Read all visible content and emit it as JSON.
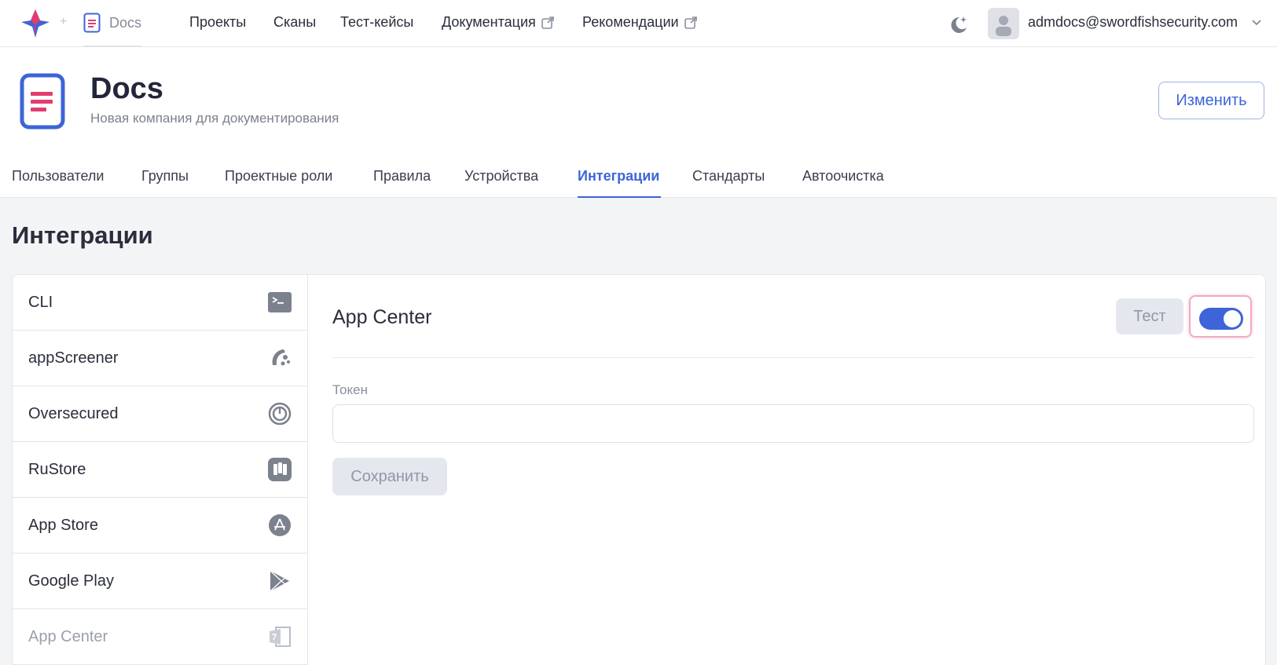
{
  "topbar": {
    "breadcrumb_label": "Docs",
    "breadcrumb_separator": "+",
    "nav": [
      {
        "label": "Проекты",
        "external": false
      },
      {
        "label": "Сканы",
        "external": false
      },
      {
        "label": "Тест-кейсы",
        "external": false
      },
      {
        "label": "Документация",
        "external": true
      },
      {
        "label": "Рекомендации",
        "external": true
      }
    ],
    "theme_icon": "moon-icon",
    "user_email": "admdocs@swordfishsecurity.com"
  },
  "company": {
    "name": "Docs",
    "description": "Новая компания для документирования",
    "edit_label": "Изменить"
  },
  "tabs": {
    "items": [
      "Пользователи",
      "Группы",
      "Проектные роли",
      "Правила",
      "Устройства",
      "Интеграции",
      "Стандарты",
      "Автоочистка"
    ],
    "active": "Интеграции"
  },
  "integrations": {
    "title": "Интеграции",
    "list": [
      {
        "label": "CLI",
        "icon": "terminal-icon"
      },
      {
        "label": "appScreener",
        "icon": "appscreener-icon"
      },
      {
        "label": "Oversecured",
        "icon": "oversecured-icon"
      },
      {
        "label": "RuStore",
        "icon": "rustore-icon"
      },
      {
        "label": "App Store",
        "icon": "app-store-icon"
      },
      {
        "label": "Google Play",
        "icon": "google-play-icon"
      },
      {
        "label": "App Center",
        "icon": "app-center-icon"
      }
    ],
    "selected": "App Center"
  },
  "panel": {
    "title": "App Center",
    "test_label": "Тест",
    "toggle_on": true,
    "token_label": "Токен",
    "token_value": "",
    "save_label": "Сохранить"
  },
  "colors": {
    "accent": "#3d64d8",
    "highlight": "#f2a9c6",
    "content_bg": "#f3f4f6"
  }
}
